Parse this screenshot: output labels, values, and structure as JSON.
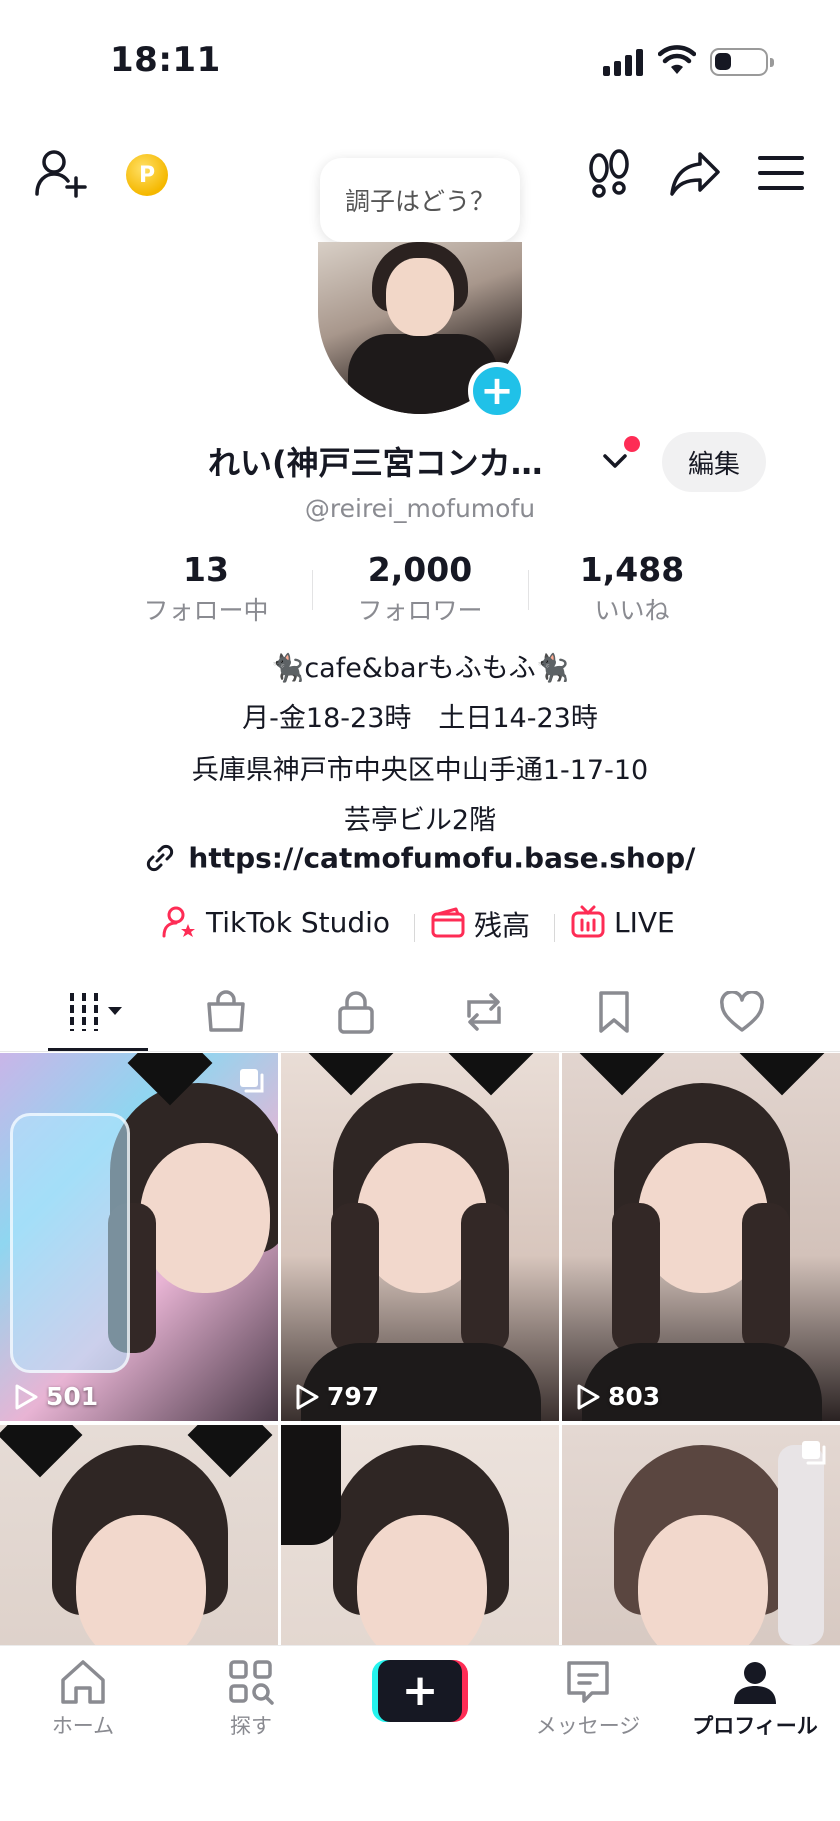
{
  "status_bar": {
    "time": "18:11"
  },
  "header": {
    "coin_icon": "coin-p-icon",
    "coin_letter": "P",
    "status_prompt": "調子はどう？"
  },
  "profile": {
    "display_name": "れい(神戸三宮コンカ…",
    "edit_label": "編集",
    "username": "@reirei_mofumofu",
    "stats": [
      {
        "value": "13",
        "label": "フォロー中"
      },
      {
        "value": "2,000",
        "label": "フォロワー"
      },
      {
        "value": "1,488",
        "label": "いいね"
      }
    ],
    "bio": {
      "line1": "🐈‍⬛cafe&barもふもふ🐈‍⬛",
      "line2": "月-金18-23時　土日14-23時",
      "line3": "兵庫県神戸市中央区中山手通1-17-10",
      "line4": "芸亭ビル2階",
      "link": "https://catmofumofu.base.shop/"
    },
    "tools": {
      "studio": "TikTok Studio",
      "balance": "残高",
      "live": "LIVE"
    }
  },
  "videos": [
    {
      "views": "501"
    },
    {
      "views": "797"
    },
    {
      "views": "803"
    },
    {
      "views": ""
    },
    {
      "views": ""
    },
    {
      "views": ""
    }
  ],
  "bottom_nav": {
    "home": "ホーム",
    "explore": "探す",
    "messages": "メッセージ",
    "profile": "プロフィール"
  },
  "colors": {
    "accent": "#fe2c55",
    "cyan": "#25f4ee",
    "badge_blue": "#20c1e8",
    "text": "#161823",
    "muted": "#8a8b91"
  }
}
